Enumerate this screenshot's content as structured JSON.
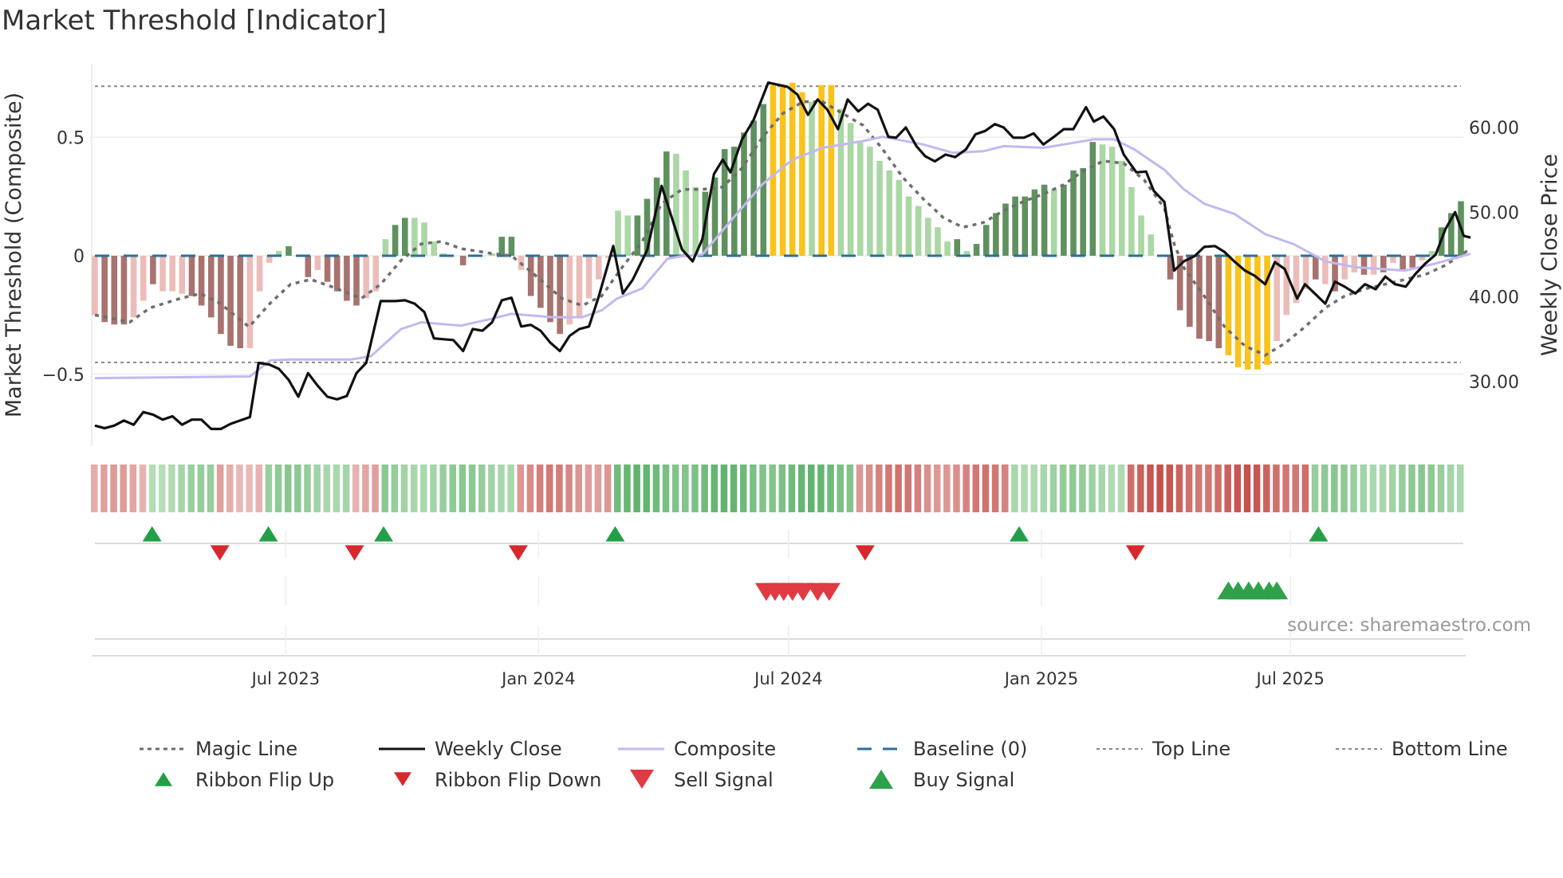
{
  "title": "Market Threshold [Indicator]",
  "source": "source: sharemaestro.com",
  "colors": {
    "dark_red": "#a8736f",
    "light_red": "#ebbdb9",
    "dark_green": "#5f915f",
    "light_green": "#abd7a4",
    "yellow": "#f9c31b",
    "close": "#111111",
    "composite": "#c3b8ef",
    "magic": "#6e6e6e",
    "baseline": "#2f6f97",
    "flip_up": "#23a047",
    "flip_down": "#d8282d",
    "sell": "#e03a42",
    "buy": "#2ea14a"
  },
  "chart_data": {
    "type": "bar",
    "title": "Market Threshold [Indicator]",
    "ylabel": "Market Threshold (Composite)",
    "y2label": "Weekly Close Price",
    "ylim": [
      -0.85,
      0.8
    ],
    "y2lim": [
      22,
      70
    ],
    "yticks": [
      {
        "v": 0.5,
        "label": "0.5"
      },
      {
        "v": 0,
        "label": "0"
      },
      {
        "v": -0.5,
        "label": "−0.5"
      }
    ],
    "y2ticks": [
      {
        "v": 60,
        "label": "60.00"
      },
      {
        "v": 50,
        "label": "50.00"
      },
      {
        "v": 40,
        "label": "40.00"
      },
      {
        "v": 30,
        "label": "30.00"
      }
    ],
    "xticks": [
      {
        "week": 19.7,
        "label": "Jul 2023"
      },
      {
        "week": 45.8,
        "label": "Jan 2024"
      },
      {
        "week": 71.6,
        "label": "Jul 2024"
      },
      {
        "week": 97.7,
        "label": "Jan 2025"
      },
      {
        "week": 123.4,
        "label": "Jul 2025"
      }
    ],
    "week_count": 142,
    "top_line": 0.715,
    "bottom_line": -0.45,
    "bars": [
      -0.25,
      -0.28,
      -0.29,
      -0.29,
      -0.26,
      -0.19,
      -0.12,
      -0.15,
      -0.15,
      -0.16,
      -0.17,
      -0.21,
      -0.26,
      -0.33,
      -0.38,
      -0.39,
      -0.39,
      -0.15,
      -0.03,
      0.02,
      0.04,
      0,
      -0.09,
      -0.06,
      -0.11,
      -0.15,
      -0.19,
      -0.21,
      -0.18,
      -0.15,
      0.07,
      0.13,
      0.16,
      0.16,
      0.14,
      0.06,
      0.01,
      0,
      -0.04,
      0,
      0,
      0.01,
      0.08,
      0.08,
      -0.06,
      -0.17,
      -0.22,
      -0.28,
      -0.33,
      -0.29,
      -0.26,
      -0.18,
      -0.1,
      -0.01,
      0.19,
      0.17,
      0.17,
      0.24,
      0.33,
      0.44,
      0.43,
      0.36,
      0.29,
      0.27,
      0.33,
      0.45,
      0.46,
      0.52,
      0.57,
      0.64,
      0.72,
      0.72,
      0.73,
      0.69,
      0.65,
      0.72,
      0.72,
      0.62,
      0.56,
      0.48,
      0.46,
      0.4,
      0.36,
      0.32,
      0.25,
      0.21,
      0.16,
      0.12,
      0.06,
      0.07,
      0.02,
      0.05,
      0.13,
      0.18,
      0.22,
      0.25,
      0.25,
      0.28,
      0.3,
      0.28,
      0.3,
      0.36,
      0.37,
      0.48,
      0.47,
      0.46,
      0.4,
      0.29,
      0.17,
      0.09,
      0,
      -0.1,
      -0.23,
      -0.3,
      -0.35,
      -0.36,
      -0.39,
      -0.42,
      -0.47,
      -0.48,
      -0.48,
      -0.46,
      -0.36,
      -0.25,
      -0.2,
      -0.14,
      -0.1,
      -0.12,
      -0.15,
      -0.1,
      -0.07,
      -0.08,
      -0.08,
      -0.07,
      -0.03,
      -0.06,
      -0.05,
      -0.02,
      0.02,
      0.12,
      0.18,
      0.23
    ],
    "bar_tones": [
      "lr",
      "dr",
      "dr",
      "dr",
      "lr",
      "lr",
      "dr",
      "lr",
      "lr",
      "lr",
      "dr",
      "dr",
      "dr",
      "dr",
      "dr",
      "dr",
      "lr",
      "lr",
      "lr",
      "lg",
      "dg",
      "lg",
      "dr",
      "lr",
      "dr",
      "dr",
      "dr",
      "dr",
      "lr",
      "lr",
      "lg",
      "dg",
      "dg",
      "lg",
      "lg",
      "lg",
      "lg",
      "lg",
      "dr",
      "lg",
      "lg",
      "lg",
      "dg",
      "dg",
      "lr",
      "dr",
      "dr",
      "dr",
      "dr",
      "lr",
      "lr",
      "lr",
      "lr",
      "lr",
      "lg",
      "lg",
      "dg",
      "dg",
      "dg",
      "dg",
      "lg",
      "lg",
      "lg",
      "dg",
      "dg",
      "dg",
      "dg",
      "dg",
      "dg",
      "dg",
      "y",
      "y",
      "y",
      "y",
      "lg",
      "y",
      "y",
      "lg",
      "lg",
      "lg",
      "lg",
      "lg",
      "lg",
      "lg",
      "lg",
      "lg",
      "lg",
      "lg",
      "lg",
      "dg",
      "lg",
      "dg",
      "dg",
      "dg",
      "dg",
      "dg",
      "dg",
      "dg",
      "dg",
      "lg",
      "dg",
      "dg",
      "dg",
      "dg",
      "lg",
      "lg",
      "lg",
      "lg",
      "lg",
      "lg",
      "lg",
      "dr",
      "dr",
      "dr",
      "dr",
      "dr",
      "dr",
      "y",
      "y",
      "y",
      "y",
      "y",
      "lr",
      "lr",
      "lr",
      "lr",
      "dr",
      "lr",
      "dr",
      "lr",
      "lr",
      "dr",
      "lr",
      "dr",
      "lr",
      "dr",
      "dr",
      "lr",
      "lg",
      "dg",
      "dg",
      "dg"
    ],
    "weekly_close": [
      [
        0,
        24.8
      ],
      [
        1,
        24.5
      ],
      [
        2,
        24.8
      ],
      [
        3,
        25.4
      ],
      [
        4,
        24.9
      ],
      [
        5,
        26.4
      ],
      [
        6,
        26.1
      ],
      [
        7,
        25.5
      ],
      [
        8,
        25.9
      ],
      [
        9,
        24.9
      ],
      [
        10,
        25.5
      ],
      [
        11,
        25.5
      ],
      [
        12,
        24.4
      ],
      [
        13,
        24.4
      ],
      [
        14,
        25.0
      ],
      [
        15,
        25.4
      ],
      [
        16,
        25.8
      ],
      [
        16.9,
        32.2
      ],
      [
        18,
        32.0
      ],
      [
        19,
        31.5
      ],
      [
        20,
        30.2
      ],
      [
        21,
        28.2
      ],
      [
        22,
        31.0
      ],
      [
        23,
        29.5
      ],
      [
        24,
        28.2
      ],
      [
        25,
        27.9
      ],
      [
        26,
        28.3
      ],
      [
        27,
        31.0
      ],
      [
        28,
        32.2
      ],
      [
        29.5,
        39.5
      ],
      [
        31,
        39.5
      ],
      [
        32,
        39.6
      ],
      [
        33,
        39.2
      ],
      [
        34,
        38.2
      ],
      [
        35,
        35.1
      ],
      [
        36,
        35.0
      ],
      [
        37,
        34.9
      ],
      [
        38,
        33.6
      ],
      [
        39,
        36.2
      ],
      [
        40,
        36.0
      ],
      [
        41,
        37.0
      ],
      [
        42,
        39.6
      ],
      [
        43,
        39.9
      ],
      [
        44,
        36.5
      ],
      [
        45,
        36.7
      ],
      [
        46,
        36.0
      ],
      [
        47,
        34.6
      ],
      [
        48,
        33.6
      ],
      [
        49,
        35.4
      ],
      [
        50,
        36.2
      ],
      [
        51,
        36.5
      ],
      [
        52,
        40.0
      ],
      [
        53.5,
        46.0
      ],
      [
        54.5,
        40.4
      ],
      [
        55.5,
        42.0
      ],
      [
        57,
        45.5
      ],
      [
        58.5,
        53.1
      ],
      [
        60.6,
        45.6
      ],
      [
        61.7,
        44.2
      ],
      [
        62.7,
        46.8
      ],
      [
        63.9,
        54.5
      ],
      [
        64.8,
        56.2
      ],
      [
        65.6,
        54.7
      ],
      [
        66.8,
        58.6
      ],
      [
        68,
        60.9
      ],
      [
        69.5,
        65.3
      ],
      [
        71.5,
        64.8
      ],
      [
        72.5,
        63.9
      ],
      [
        73.6,
        61.5
      ],
      [
        74.6,
        63.3
      ],
      [
        75.6,
        62.1
      ],
      [
        76.7,
        59.8
      ],
      [
        77.7,
        63.3
      ],
      [
        78.8,
        61.9
      ],
      [
        79.8,
        62.8
      ],
      [
        80.8,
        62.1
      ],
      [
        81.9,
        58.9
      ],
      [
        82.7,
        58.8
      ],
      [
        83.7,
        60.0
      ],
      [
        84.8,
        57.8
      ],
      [
        85.7,
        56.6
      ],
      [
        86.7,
        56.0
      ],
      [
        87.8,
        56.8
      ],
      [
        88.8,
        56.5
      ],
      [
        89.9,
        57.4
      ],
      [
        90.9,
        59.2
      ],
      [
        91.9,
        59.6
      ],
      [
        92.9,
        60.4
      ],
      [
        93.8,
        60.0
      ],
      [
        94.8,
        58.8
      ],
      [
        95.9,
        58.8
      ],
      [
        96.9,
        59.3
      ],
      [
        97.9,
        58.0
      ],
      [
        99,
        58.9
      ],
      [
        100,
        59.8
      ],
      [
        101,
        59.8
      ],
      [
        102.3,
        62.4
      ],
      [
        103.1,
        60.7
      ],
      [
        104.1,
        61.3
      ],
      [
        105.2,
        59.8
      ],
      [
        106.2,
        56.8
      ],
      [
        107.5,
        54.7
      ],
      [
        108.5,
        54.8
      ],
      [
        109.3,
        52.5
      ],
      [
        110.4,
        51.2
      ],
      [
        111.4,
        43.1
      ],
      [
        112.4,
        44.2
      ],
      [
        113.5,
        44.8
      ],
      [
        114.5,
        45.9
      ],
      [
        115.6,
        46.0
      ],
      [
        116.6,
        45.3
      ],
      [
        117.6,
        44.2
      ],
      [
        118.7,
        43.1
      ],
      [
        119.7,
        42.5
      ],
      [
        120.8,
        41.5
      ],
      [
        121.8,
        44.1
      ],
      [
        122.8,
        43.3
      ],
      [
        124.1,
        39.8
      ],
      [
        124.9,
        41.5
      ],
      [
        125.9,
        40.4
      ],
      [
        127,
        39.2
      ],
      [
        128,
        41.8
      ],
      [
        129,
        41.2
      ],
      [
        130.1,
        40.4
      ],
      [
        131.1,
        41.5
      ],
      [
        132.2,
        40.9
      ],
      [
        133.2,
        42.4
      ],
      [
        134.2,
        41.5
      ],
      [
        135.3,
        41.2
      ],
      [
        136.3,
        42.7
      ],
      [
        137.3,
        43.9
      ],
      [
        138.4,
        45.0
      ],
      [
        139.4,
        48.0
      ],
      [
        140.4,
        50.0
      ],
      [
        141.3,
        47.2
      ],
      [
        142,
        47.0
      ]
    ],
    "composite_line": [
      [
        0,
        30.4
      ],
      [
        16,
        30.6
      ],
      [
        18.1,
        32.5
      ],
      [
        20.2,
        32.6
      ],
      [
        26.4,
        32.6
      ],
      [
        28.5,
        33.0
      ],
      [
        31.6,
        36.2
      ],
      [
        33.7,
        37.0
      ],
      [
        37.8,
        36.6
      ],
      [
        40.9,
        37.4
      ],
      [
        43,
        38.0
      ],
      [
        47.2,
        37.6
      ],
      [
        50.3,
        37.6
      ],
      [
        52.3,
        38.4
      ],
      [
        53.9,
        39.8
      ],
      [
        56.5,
        41.0
      ],
      [
        59.1,
        44.5
      ],
      [
        60.6,
        44.8
      ],
      [
        62.7,
        45.0
      ],
      [
        65.8,
        49.2
      ],
      [
        68.9,
        53.3
      ],
      [
        72,
        56.2
      ],
      [
        75.1,
        57.6
      ],
      [
        79.3,
        58.4
      ],
      [
        81.3,
        58.9
      ],
      [
        85.5,
        58.0
      ],
      [
        88.6,
        57.0
      ],
      [
        91.7,
        57.2
      ],
      [
        93.8,
        57.8
      ],
      [
        97.9,
        57.6
      ],
      [
        100,
        58.0
      ],
      [
        103.1,
        58.6
      ],
      [
        105.2,
        58.6
      ],
      [
        107.3,
        57.4
      ],
      [
        110.4,
        55.0
      ],
      [
        112.4,
        52.7
      ],
      [
        114.5,
        51.0
      ],
      [
        117.6,
        49.8
      ],
      [
        120.8,
        47.4
      ],
      [
        123.8,
        46.2
      ],
      [
        127,
        44.2
      ],
      [
        130.1,
        43.5
      ],
      [
        135.2,
        43.1
      ],
      [
        138.3,
        43.9
      ],
      [
        142,
        45.1
      ]
    ],
    "magic_line": [
      [
        0,
        -0.25
      ],
      [
        3.6,
        -0.28
      ],
      [
        5.7,
        -0.22
      ],
      [
        8.8,
        -0.18
      ],
      [
        10.9,
        -0.16
      ],
      [
        12.9,
        -0.2
      ],
      [
        15.9,
        -0.3
      ],
      [
        18.1,
        -0.2
      ],
      [
        20.2,
        -0.12
      ],
      [
        22.3,
        -0.1
      ],
      [
        24.4,
        -0.13
      ],
      [
        27.5,
        -0.18
      ],
      [
        29.5,
        -0.12
      ],
      [
        31.6,
        -0.02
      ],
      [
        33.7,
        0.05
      ],
      [
        35.8,
        0.06
      ],
      [
        37.8,
        0.03
      ],
      [
        40.9,
        0.01
      ],
      [
        43,
        0.0
      ],
      [
        45.1,
        -0.07
      ],
      [
        48.2,
        -0.18
      ],
      [
        50.3,
        -0.21
      ],
      [
        52.3,
        -0.17
      ],
      [
        54.4,
        -0.05
      ],
      [
        56.5,
        0.06
      ],
      [
        58.5,
        0.22
      ],
      [
        60.6,
        0.28
      ],
      [
        62.7,
        0.28
      ],
      [
        64.8,
        0.29
      ],
      [
        66.8,
        0.37
      ],
      [
        68.9,
        0.5
      ],
      [
        71,
        0.6
      ],
      [
        73.1,
        0.65
      ],
      [
        75.1,
        0.65
      ],
      [
        77.2,
        0.6
      ],
      [
        79.3,
        0.55
      ],
      [
        81.3,
        0.45
      ],
      [
        83.4,
        0.33
      ],
      [
        85.5,
        0.24
      ],
      [
        87.6,
        0.16
      ],
      [
        89.6,
        0.12
      ],
      [
        91.7,
        0.14
      ],
      [
        93.8,
        0.19
      ],
      [
        95.9,
        0.23
      ],
      [
        97.9,
        0.26
      ],
      [
        100,
        0.3
      ],
      [
        102.1,
        0.36
      ],
      [
        104.1,
        0.4
      ],
      [
        106.2,
        0.39
      ],
      [
        108.3,
        0.32
      ],
      [
        110.4,
        0.2
      ],
      [
        111.4,
        0.05
      ],
      [
        112.4,
        -0.05
      ],
      [
        114.5,
        -0.17
      ],
      [
        116.6,
        -0.3
      ],
      [
        118.7,
        -0.38
      ],
      [
        120.8,
        -0.42
      ],
      [
        122.8,
        -0.37
      ],
      [
        124.9,
        -0.3
      ],
      [
        127,
        -0.22
      ],
      [
        129,
        -0.17
      ],
      [
        131.1,
        -0.14
      ],
      [
        133.2,
        -0.12
      ],
      [
        135.2,
        -0.1
      ],
      [
        137.3,
        -0.08
      ],
      [
        139.4,
        -0.04
      ],
      [
        142,
        0.03
      ]
    ],
    "ribbon": [
      {
        "from": 0,
        "to": 5.5,
        "tone": "red",
        "level": 0.3
      },
      {
        "from": 5.5,
        "to": 12.5,
        "tone": "green",
        "level": 0.4
      },
      {
        "from": 12.5,
        "to": 17.5,
        "tone": "red",
        "level": 0.35
      },
      {
        "from": 17.5,
        "to": 26.5,
        "tone": "green",
        "level": 0.5
      },
      {
        "from": 26.5,
        "to": 29.5,
        "tone": "red",
        "level": 0.25
      },
      {
        "from": 29.5,
        "to": 43.3,
        "tone": "green",
        "level": 0.5
      },
      {
        "from": 43.3,
        "to": 53.3,
        "tone": "red",
        "level": 0.55
      },
      {
        "from": 53.3,
        "to": 79,
        "tone": "green",
        "level": 0.85
      },
      {
        "from": 79,
        "to": 95,
        "tone": "red",
        "level": 0.6
      },
      {
        "from": 95,
        "to": 107,
        "tone": "green",
        "level": 0.45
      },
      {
        "from": 107,
        "to": 126,
        "tone": "red",
        "level": 0.85
      },
      {
        "from": 126,
        "to": 142,
        "tone": "green",
        "level": 0.5
      }
    ],
    "ribbon_flip_up": [
      5.9,
      17.9,
      29.8,
      53.7,
      95.4,
      126.3
    ],
    "ribbon_flip_down": [
      12.9,
      26.8,
      43.7,
      79.5,
      107.4
    ],
    "sell_signals": [
      69.3,
      70.2,
      71.1,
      72.0,
      73.1,
      74.6,
      75.8
    ],
    "buy_signals": [
      117,
      118,
      119.1,
      120.1,
      121.2,
      122
    ]
  },
  "legend": [
    {
      "label": "Magic Line",
      "kind": "dotted",
      "color": "#6e6e6e"
    },
    {
      "label": "Weekly Close",
      "kind": "solid",
      "color": "#111111"
    },
    {
      "label": "Composite",
      "kind": "solid-light",
      "color": "#c3b8ef"
    },
    {
      "label": "Baseline (0)",
      "kind": "dashed",
      "color": "#2f6f97"
    },
    {
      "label": "Top Line",
      "kind": "fine-dotted",
      "color": "#8a8a8a"
    },
    {
      "label": "Bottom Line",
      "kind": "fine-dotted",
      "color": "#8a8a8a"
    },
    {
      "label": "Ribbon Flip Up",
      "kind": "tri-up",
      "color": "#23a047"
    },
    {
      "label": "Ribbon Flip Down",
      "kind": "tri-down",
      "color": "#d8282d"
    },
    {
      "label": "Sell Signal",
      "kind": "tri-down-big",
      "color": "#e03a42"
    },
    {
      "label": "Buy Signal",
      "kind": "tri-up-big",
      "color": "#2ea14a"
    }
  ]
}
